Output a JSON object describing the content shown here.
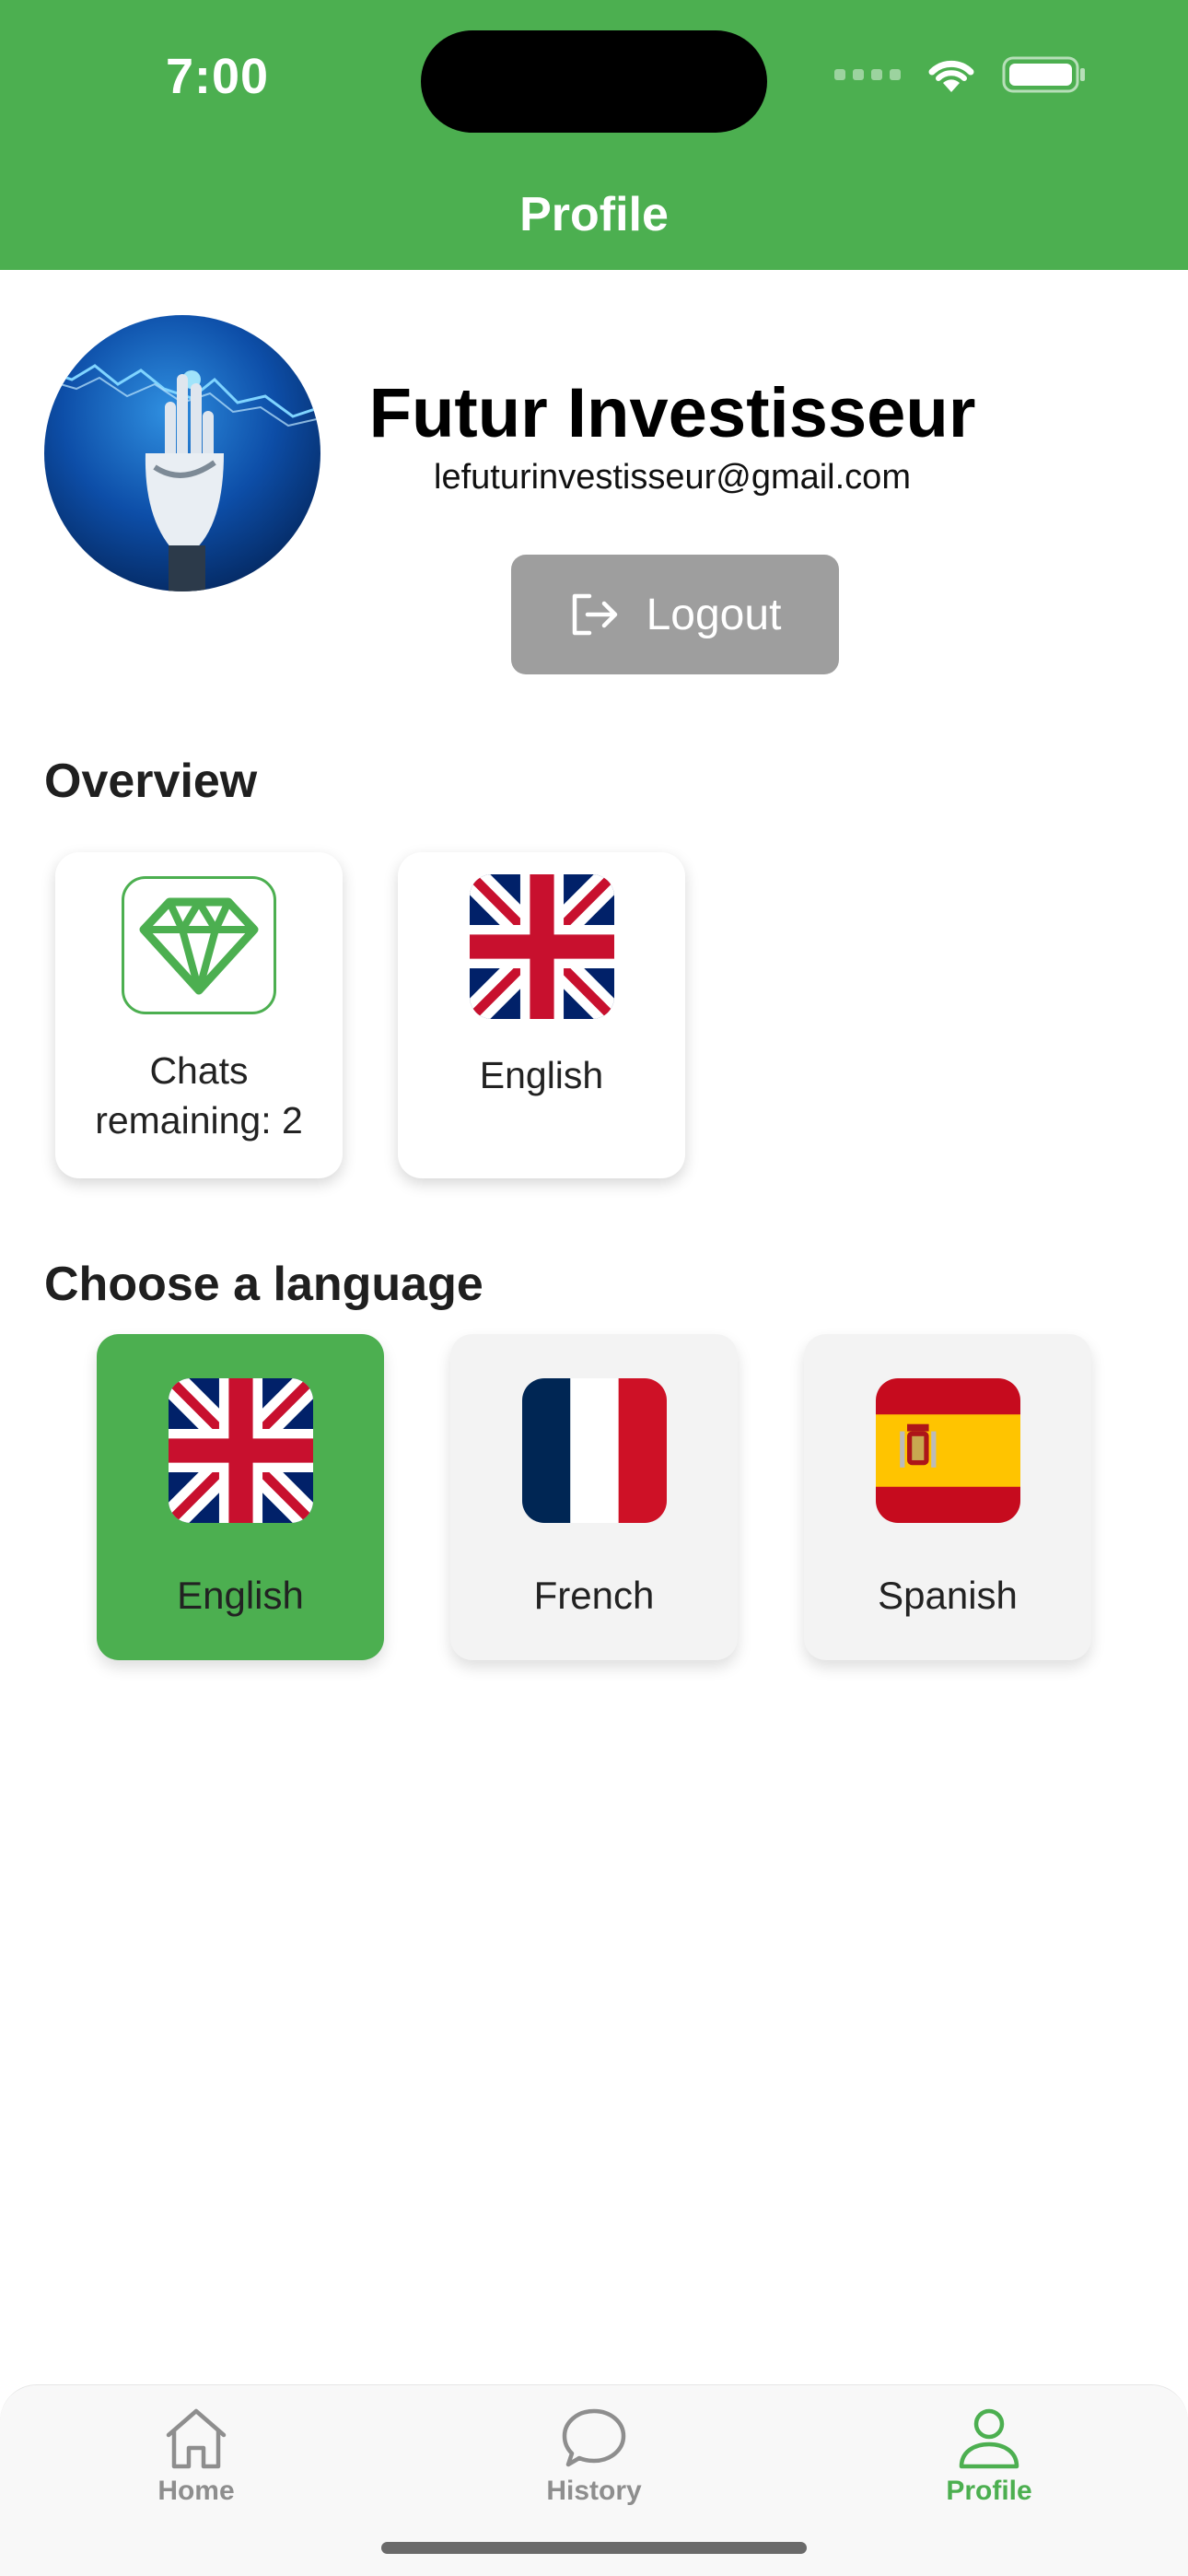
{
  "status_bar": {
    "time": "7:00"
  },
  "header": {
    "title": "Profile"
  },
  "profile": {
    "name": "Futur Investisseur",
    "email": "lefuturinvestisseur@gmail.com",
    "logout_label": "Logout"
  },
  "overview": {
    "title": "Overview",
    "chats_line1": "Chats",
    "chats_line2": "remaining: 2",
    "current_language": "English"
  },
  "languages": {
    "title": "Choose a language",
    "items": [
      {
        "label": "English",
        "selected": true
      },
      {
        "label": "French",
        "selected": false
      },
      {
        "label": "Spanish",
        "selected": false
      }
    ]
  },
  "tabbar": {
    "items": [
      {
        "label": "Home",
        "icon": "home-icon",
        "active": false
      },
      {
        "label": "History",
        "icon": "chat-bubble-icon",
        "active": false
      },
      {
        "label": "Profile",
        "icon": "person-icon",
        "active": true
      }
    ]
  },
  "colors": {
    "accent": "#4caf50",
    "logout_button": "#9e9e9e",
    "inactive_tab": "#8e8e8e"
  }
}
